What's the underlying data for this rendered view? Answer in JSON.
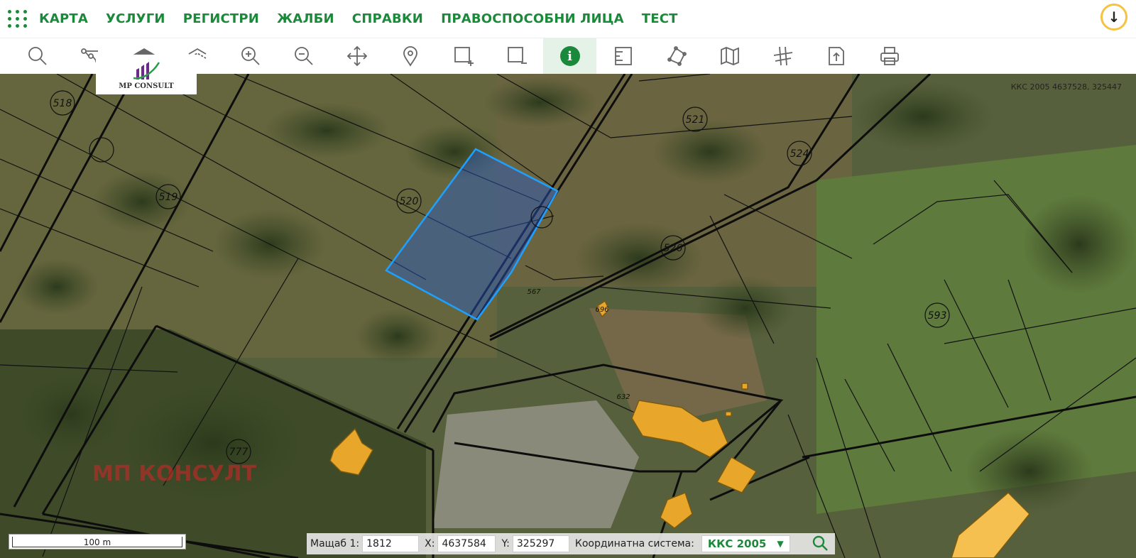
{
  "nav": {
    "items": [
      "КАРТА",
      "УСЛУГИ",
      "РЕГИСТРИ",
      "ЖАЛБИ",
      "СПРАВКИ",
      "ПРАВОСПОСОБНИ ЛИЦА",
      "ТЕСТ"
    ]
  },
  "toolbar": {
    "tools": [
      "search-icon",
      "route-icon",
      "layer-up-icon",
      "layer-down-icon",
      "zoom-in-icon",
      "zoom-out-icon",
      "pan-icon",
      "marker-icon",
      "select-add-icon",
      "select-remove-icon",
      "info-icon",
      "measure-icon",
      "polygon-icon",
      "map-icon",
      "grid-icon",
      "export-icon",
      "print-icon"
    ],
    "active": "info-icon"
  },
  "logo": {
    "text": "MP CONSULT"
  },
  "map": {
    "coordinate_readout": "ККС 2005 4637528, 325447",
    "watermark": "МП КОНСУЛТ",
    "scale_label": "100 m",
    "parcel_labels": [
      "518",
      "520",
      "519",
      "521",
      "524",
      "526",
      "593",
      "777",
      "696",
      "632",
      "567"
    ],
    "highlight_color": "#1ea0ff"
  },
  "status": {
    "scale_label": "Мащаб 1:",
    "scale_value": "1812",
    "x_label": "X:",
    "x_value": "4637584",
    "y_label": "Y:",
    "y_value": "325297",
    "crs_label": "Координатна система:",
    "crs_value": "ККС 2005"
  },
  "colors": {
    "accent": "#1a8a3a",
    "building": "#e8a62a"
  }
}
